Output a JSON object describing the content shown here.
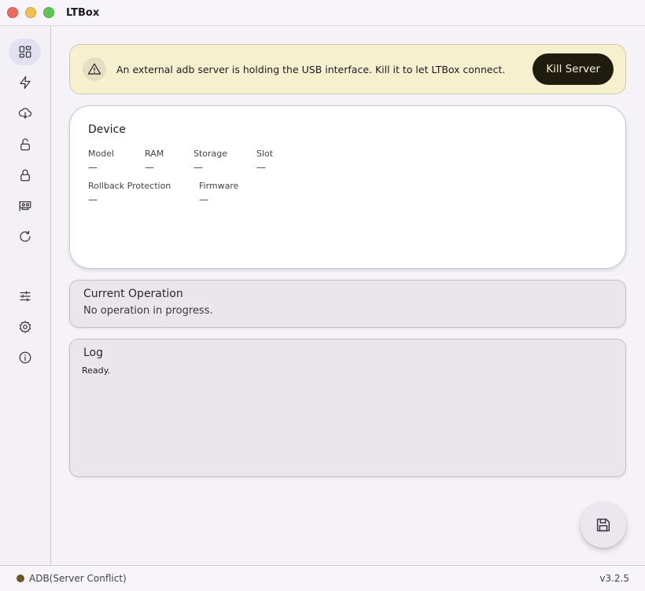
{
  "app": {
    "title": "LTBox",
    "version": "v3.2.5"
  },
  "colors": {
    "status_dot": "#6b5520",
    "banner_bg": "#f6f0cf",
    "kill_button_bg": "#1f1b0f",
    "nav_active_bg": "#e2e1f2"
  },
  "sidebar": {
    "items": [
      {
        "icon": "dashboard-icon",
        "active": true
      },
      {
        "icon": "lightning-icon",
        "active": false
      },
      {
        "icon": "cloud-download-icon",
        "active": false
      },
      {
        "icon": "unlock-icon",
        "active": false
      },
      {
        "icon": "lock-icon",
        "active": false
      },
      {
        "icon": "memory-card-icon",
        "active": false
      },
      {
        "icon": "refresh-icon",
        "active": false
      },
      {
        "icon": "tune-icon",
        "active": false
      },
      {
        "icon": "gear-icon",
        "active": false
      },
      {
        "icon": "info-icon",
        "active": false
      }
    ]
  },
  "banner": {
    "icon": "warning-icon",
    "message": "An external adb server is holding the USB interface. Kill it to let LTBox connect.",
    "button_label": "Kill Server"
  },
  "device": {
    "title": "Device",
    "fields": {
      "model": {
        "label": "Model",
        "value": "—"
      },
      "ram": {
        "label": "RAM",
        "value": "—"
      },
      "storage": {
        "label": "Storage",
        "value": "—"
      },
      "slot": {
        "label": "Slot",
        "value": "—"
      },
      "rollback": {
        "label": "Rollback Protection",
        "value": "—"
      },
      "firmware": {
        "label": "Firmware",
        "value": "—"
      }
    }
  },
  "operation": {
    "title": "Current Operation",
    "status": "No operation in progress."
  },
  "log": {
    "title": "Log",
    "text": "Ready."
  },
  "fab": {
    "icon": "save-icon"
  },
  "statusbar": {
    "adb_status": "ADB(Server Conflict)"
  }
}
